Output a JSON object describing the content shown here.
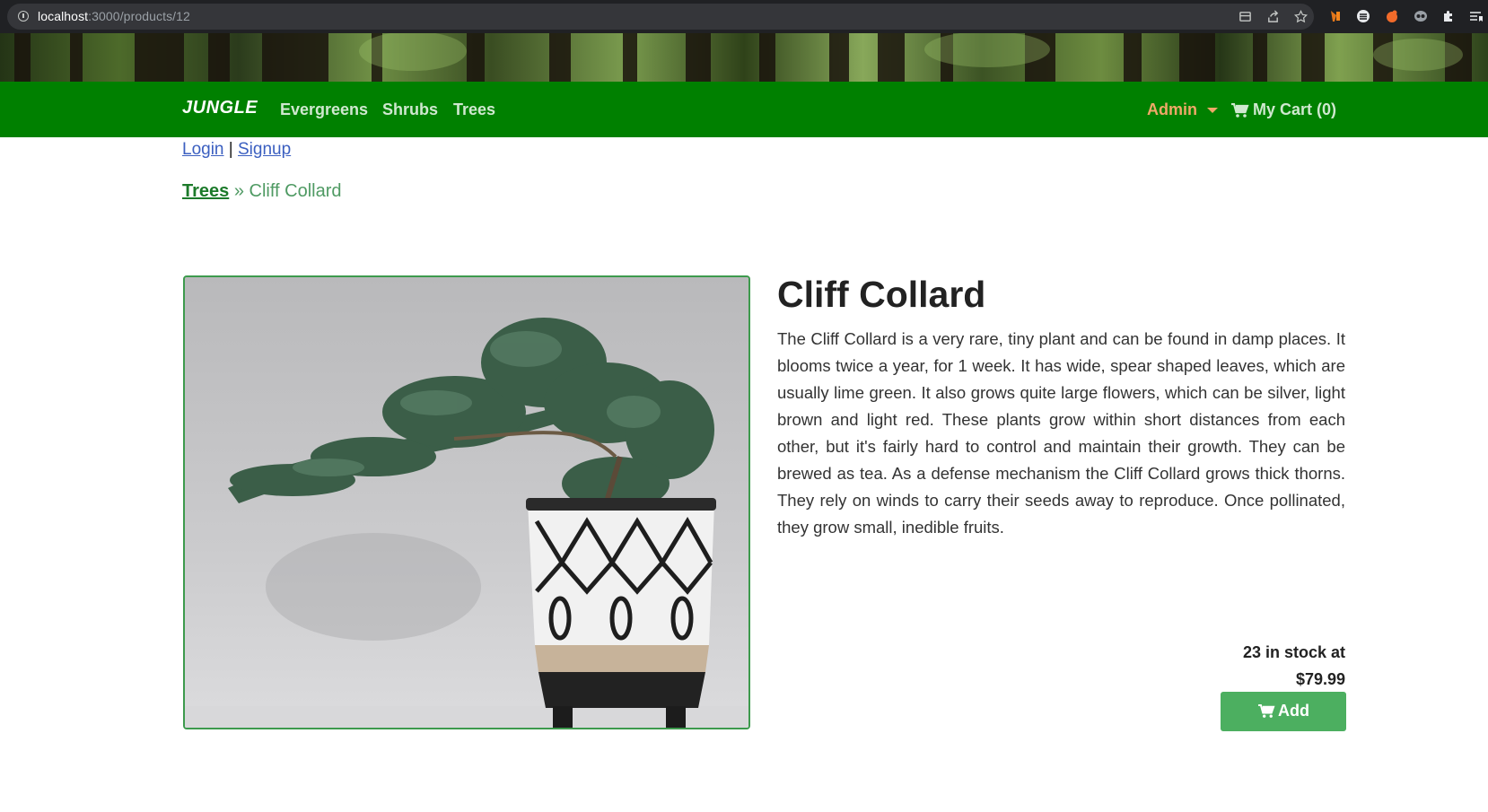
{
  "browser": {
    "url_host": "localhost",
    "url_path": ":3000/products/12"
  },
  "navbar": {
    "brand": "JUNGLE",
    "links": [
      "Evergreens",
      "Shrubs",
      "Trees"
    ],
    "admin_label": "Admin",
    "cart_label": "My Cart (0)"
  },
  "auth": {
    "login": "Login",
    "separator": "|",
    "signup": "Signup"
  },
  "breadcrumb": {
    "category": "Trees",
    "separator": "»",
    "current": "Cliff Collard"
  },
  "product": {
    "name": "Cliff Collard",
    "description": "The Cliff Collard is a very rare, tiny plant and can be found in damp places. It blooms twice a year, for 1 week. It has wide, spear shaped leaves, which are usually lime green. It also grows quite large flowers, which can be silver, light brown and light red. These plants grow within short distances from each other, but it's fairly hard to control and maintain their growth. They can be brewed as tea. As a defense mechanism the Cliff Collard grows thick thorns. They rely on winds to carry their seeds away to reproduce. Once pollinated, they grow small, inedible fruits.",
    "stock_line": "23 in stock at",
    "price": "$79.99",
    "add_label": "Add"
  },
  "colors": {
    "navbar": "#008000",
    "admin": "#f0a868",
    "add_button": "#4caf60"
  }
}
